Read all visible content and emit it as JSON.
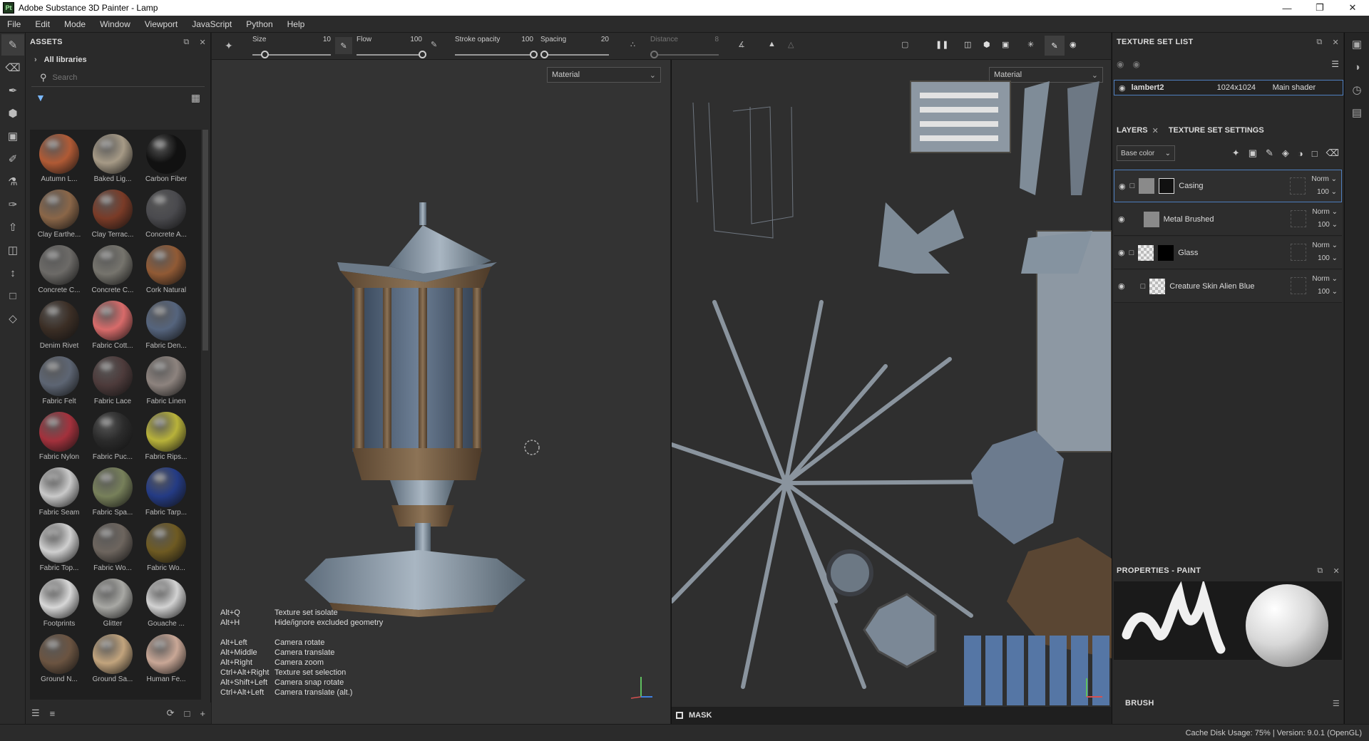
{
  "window": {
    "title": "Adobe Substance 3D Painter - Lamp",
    "app_icon": "Pt"
  },
  "menu": [
    "File",
    "Edit",
    "Mode",
    "Window",
    "Viewport",
    "JavaScript",
    "Python",
    "Help"
  ],
  "assets": {
    "title": "ASSETS",
    "all_libraries": "All libraries",
    "search_placeholder": "Search",
    "items": [
      {
        "name": "Autumn L...",
        "color": "#b05a35"
      },
      {
        "name": "Baked Lig...",
        "color": "#a69a86"
      },
      {
        "name": "Carbon Fiber",
        "color": "#111111"
      },
      {
        "name": "Clay Earthe...",
        "color": "#8a6648"
      },
      {
        "name": "Clay Terrac...",
        "color": "#7a3b27"
      },
      {
        "name": "Concrete A...",
        "color": "#4a4a4e"
      },
      {
        "name": "Concrete C...",
        "color": "#6c6a67"
      },
      {
        "name": "Concrete C...",
        "color": "#76746d"
      },
      {
        "name": "Cork Natural",
        "color": "#915a35"
      },
      {
        "name": "Denim Rivet",
        "color": "#3b2e25"
      },
      {
        "name": "Fabric Cott...",
        "color": "#d86b6a"
      },
      {
        "name": "Fabric Den...",
        "color": "#55647d"
      },
      {
        "name": "Fabric Felt",
        "color": "#5d6573"
      },
      {
        "name": "Fabric Lace",
        "color": "#4d3b3b"
      },
      {
        "name": "Fabric Linen",
        "color": "#8d837e"
      },
      {
        "name": "Fabric Nylon",
        "color": "#a3313c"
      },
      {
        "name": "Fabric Puc...",
        "color": "#2b2b2b"
      },
      {
        "name": "Fabric Rips...",
        "color": "#b8b23a"
      },
      {
        "name": "Fabric Seam",
        "color": "#c9c9c9"
      },
      {
        "name": "Fabric Spa...",
        "color": "#77805a"
      },
      {
        "name": "Fabric Tarp...",
        "color": "#243b84"
      },
      {
        "name": "Fabric Top...",
        "color": "#cfcfcf"
      },
      {
        "name": "Fabric Wo...",
        "color": "#6d655e"
      },
      {
        "name": "Fabric Wo...",
        "color": "#6e5a22"
      },
      {
        "name": "Footprints",
        "color": "#d7d7d7"
      },
      {
        "name": "Glitter",
        "color": "#a8a8a4"
      },
      {
        "name": "Gouache ...",
        "color": "#d2d2d2"
      },
      {
        "name": "Ground N...",
        "color": "#6b5441"
      },
      {
        "name": "Ground Sa...",
        "color": "#c2a47d"
      },
      {
        "name": "Human Fe...",
        "color": "#c9a796"
      }
    ]
  },
  "tool_options": {
    "size_label": "Size",
    "size_value": "10",
    "size_level": 0.15,
    "flow_label": "Flow",
    "flow_value": "100",
    "flow_level": 1.0,
    "stroke_label": "Stroke opacity",
    "stroke_value": "100",
    "stroke_level": 1.0,
    "spacing_label": "Spacing",
    "spacing_value": "20",
    "spacing_level": 0.05,
    "distance_label": "Distance",
    "distance_value": "8",
    "distance_level": 0.05
  },
  "viewport3d": {
    "material_select": "Material",
    "shortcuts": [
      {
        "key": "Alt+Q",
        "action": "Texture set isolate"
      },
      {
        "key": "Alt+H",
        "action": "Hide/ignore excluded geometry"
      },
      {
        "key": "",
        "action": ""
      },
      {
        "key": "Alt+Left",
        "action": "Camera rotate"
      },
      {
        "key": "Alt+Middle",
        "action": "Camera translate"
      },
      {
        "key": "Alt+Right",
        "action": "Camera zoom"
      },
      {
        "key": "Ctrl+Alt+Right",
        "action": "Texture set selection"
      },
      {
        "key": "Alt+Shift+Left",
        "action": "Camera snap rotate"
      },
      {
        "key": "Ctrl+Alt+Left",
        "action": "Camera translate (alt.)"
      }
    ]
  },
  "viewport2d": {
    "material_select": "Material",
    "mask_label": "MASK"
  },
  "texture_set_list": {
    "title": "TEXTURE SET LIST",
    "row": {
      "name": "lambert2",
      "resolution": "1024x1024",
      "shader": "Main shader"
    }
  },
  "layers": {
    "tab_layers": "LAYERS",
    "tab_settings": "TEXTURE SET SETTINGS",
    "channel": "Base color",
    "items": [
      {
        "name": "Casing",
        "blend": "Norm",
        "opacity": "100"
      },
      {
        "name": "Metal Brushed",
        "blend": "Norm",
        "opacity": "100"
      },
      {
        "name": "Glass",
        "blend": "Norm",
        "opacity": "100"
      },
      {
        "name": "Creature Skin Alien Blue",
        "blend": "Norm",
        "opacity": "100"
      }
    ]
  },
  "properties": {
    "title": "PROPERTIES - PAINT",
    "brush_label": "BRUSH"
  },
  "status": {
    "text": "Cache Disk Usage:   75% | Version: 9.0.1 (OpenGL)"
  }
}
